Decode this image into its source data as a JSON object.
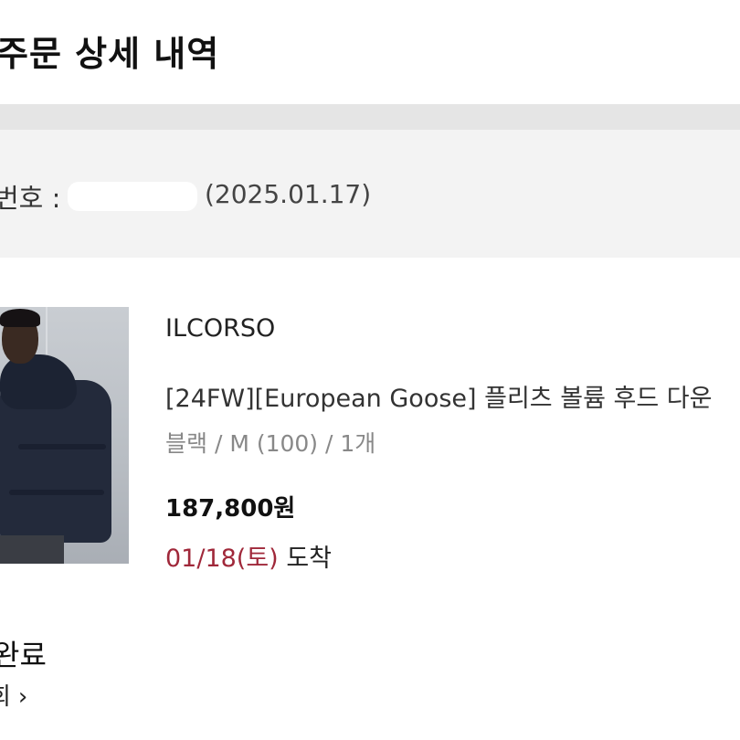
{
  "header": {
    "title": "주문 상세 내역"
  },
  "order_info": {
    "number_label": "번호 :",
    "date": "(2025.01.17)"
  },
  "product": {
    "image_icon": "product-photo",
    "brand": "ILCORSO",
    "name": "[24FW][European Goose] 플리츠 볼륨 후드 다운",
    "options": "블랙 / M (100) / 1개",
    "price": "187,800원",
    "delivery_date": "01/18(토)",
    "delivery_status": "도착"
  },
  "status": {
    "label": "완료",
    "link_label": "회",
    "link_icon": "chevron-right-icon"
  },
  "colors": {
    "delivery_accent": "#a0283a",
    "band": "#e5e5e5",
    "info_bg": "#f3f3f3"
  }
}
